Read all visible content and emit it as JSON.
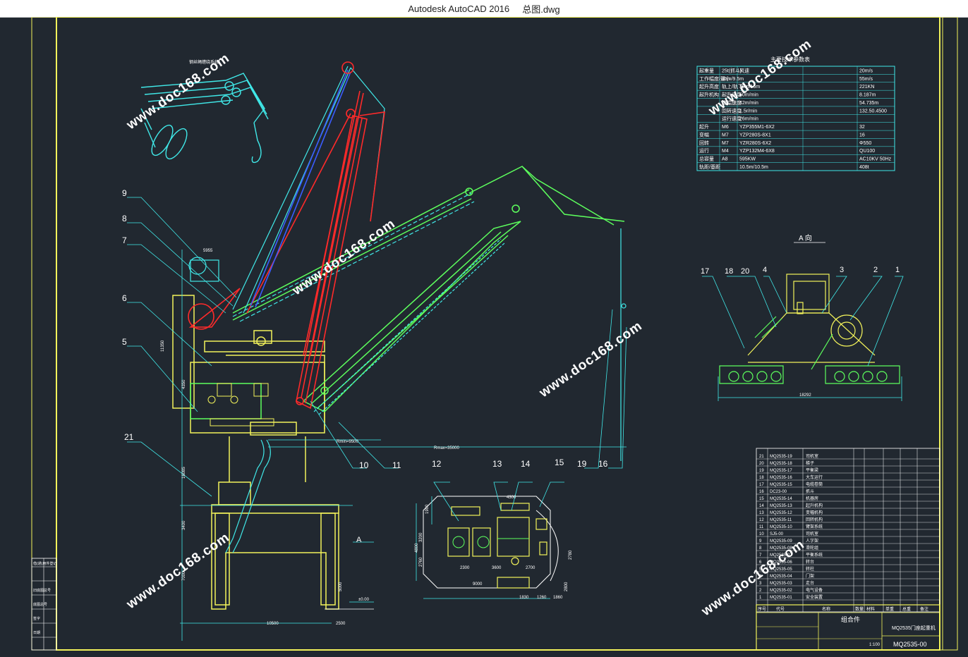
{
  "window": {
    "app_title": "Autodesk AutoCAD 2016",
    "file_name": "总图.dwg"
  },
  "watermark": "www.doc168.com",
  "colors": {
    "background": "#212830",
    "border": "#f2f25a",
    "crane_yellow": "#f2f25a",
    "crane_green": "#5dff5d",
    "crane_cyan": "#40e8e8",
    "crane_red": "#ff2a2a",
    "crane_blue": "#3a5cff",
    "table_cyan": "#40e8e8",
    "text_white": "#ffffff"
  },
  "spec_table": {
    "title": "主要技术参数表",
    "rows": [
      [
        "起重量",
        "25t(抓斗)",
        "风速",
        "20m/s"
      ],
      [
        "工作幅度/最小",
        "35m/9.5m",
        "",
        "55m/s"
      ],
      [
        "起升高度",
        "轨上/轨下",
        "30m/15m",
        "221KN"
      ],
      [
        "起升机构",
        "起升速度",
        "50m/min",
        "8.187m"
      ],
      [
        "",
        "变幅速度",
        "42m/min",
        "54.735m"
      ],
      [
        "",
        "回转速度",
        "1.5r/min",
        "132.50.4500"
      ],
      [
        "",
        "运行速度",
        "26m/min",
        ""
      ],
      [
        "起升",
        "M6",
        "YZP355M1-6X2",
        "32"
      ],
      [
        "变幅",
        "M7",
        "YZP280S-8X1",
        "16"
      ],
      [
        "回转",
        "M7",
        "YZR280S-6X2",
        "Φ550"
      ],
      [
        "运行",
        "M4",
        "YZP132M4-6X8",
        "QU100"
      ],
      [
        "总容量",
        "A8",
        "595KW",
        "AC10KV 50Hz"
      ],
      [
        "轨距/基距",
        "",
        "10.5m/10.5m",
        "408t"
      ]
    ]
  },
  "callouts": [
    "9",
    "8",
    "7",
    "6",
    "5",
    "21",
    "10",
    "11",
    "12",
    "13",
    "14",
    "15",
    "19",
    "16"
  ],
  "view_a": {
    "title": "A 向",
    "callouts": [
      "17",
      "18",
      "20",
      "4",
      "3",
      "2",
      "1"
    ],
    "dimension": "18292"
  },
  "section_marker": "A",
  "dims": {
    "rmin": "Rmin=9500",
    "rmax": "Rmax=35000",
    "d1": "5955",
    "d2": "11350",
    "d3": "4350",
    "d4": "16085",
    "d5": "3400",
    "d6": "7000",
    "d7": "5000",
    "d8": "10500",
    "d9": "2500",
    "d10": "±0.00",
    "p1": "4300",
    "p2": "9000",
    "p3": "1830",
    "p4": "1260",
    "p5": "1860",
    "p6": "2780",
    "p7": "3600",
    "p8": "2700",
    "p9": "2300",
    "p10": "2800",
    "p11": "2760",
    "p12": "3200",
    "p13": "1900",
    "p14": "4800"
  },
  "parts_list": {
    "rows": [
      [
        "21",
        "MQ2535-19",
        "司机室"
      ],
      [
        "20",
        "MQ2535-18",
        "梯子"
      ],
      [
        "19",
        "MQ2535-17",
        "平衡梁"
      ],
      [
        "18",
        "MQ2535-16",
        "大车运行"
      ],
      [
        "17",
        "MQ2535-15",
        "电缆卷筒"
      ],
      [
        "16",
        "DC23-00",
        "抓斗"
      ],
      [
        "15",
        "MQ2535-14",
        "机器房"
      ],
      [
        "14",
        "MQ2535-13",
        "起升机构"
      ],
      [
        "13",
        "MQ2535-12",
        "变幅机构"
      ],
      [
        "12",
        "MQ2535-11",
        "回转机构"
      ],
      [
        "11",
        "MQ2535-10",
        "臂架系统"
      ],
      [
        "10",
        "SJ5-00",
        "司机室"
      ],
      [
        "9",
        "MQ2535-09",
        "人字架"
      ],
      [
        "8",
        "MQ2535-08",
        "滑轮组"
      ],
      [
        "7",
        "MQ2535-07",
        "平衡系统"
      ],
      [
        "6",
        "MQ2535-06",
        "转台"
      ],
      [
        "5",
        "MQ2535-05",
        "转柱"
      ],
      [
        "4",
        "MQ2535-04",
        "门架"
      ],
      [
        "3",
        "MQ2535-03",
        "走台"
      ],
      [
        "2",
        "MQ2535-02",
        "电气设备"
      ],
      [
        "1",
        "MQ2535-01",
        "安全装置"
      ]
    ],
    "header": [
      "序号",
      "代号",
      "名称",
      "数量",
      "材料",
      "单重",
      "总重",
      "备注"
    ]
  },
  "title_block": {
    "assembly_label": "组合件",
    "drawing_title": "MQ2535门座起重机",
    "drawing_number": "MQ2535-00",
    "scale": "1:100"
  },
  "left_strip": {
    "labels": [
      "借(通)用件登记",
      "旧底图总号",
      "底图总号",
      "签字",
      "日期"
    ]
  }
}
